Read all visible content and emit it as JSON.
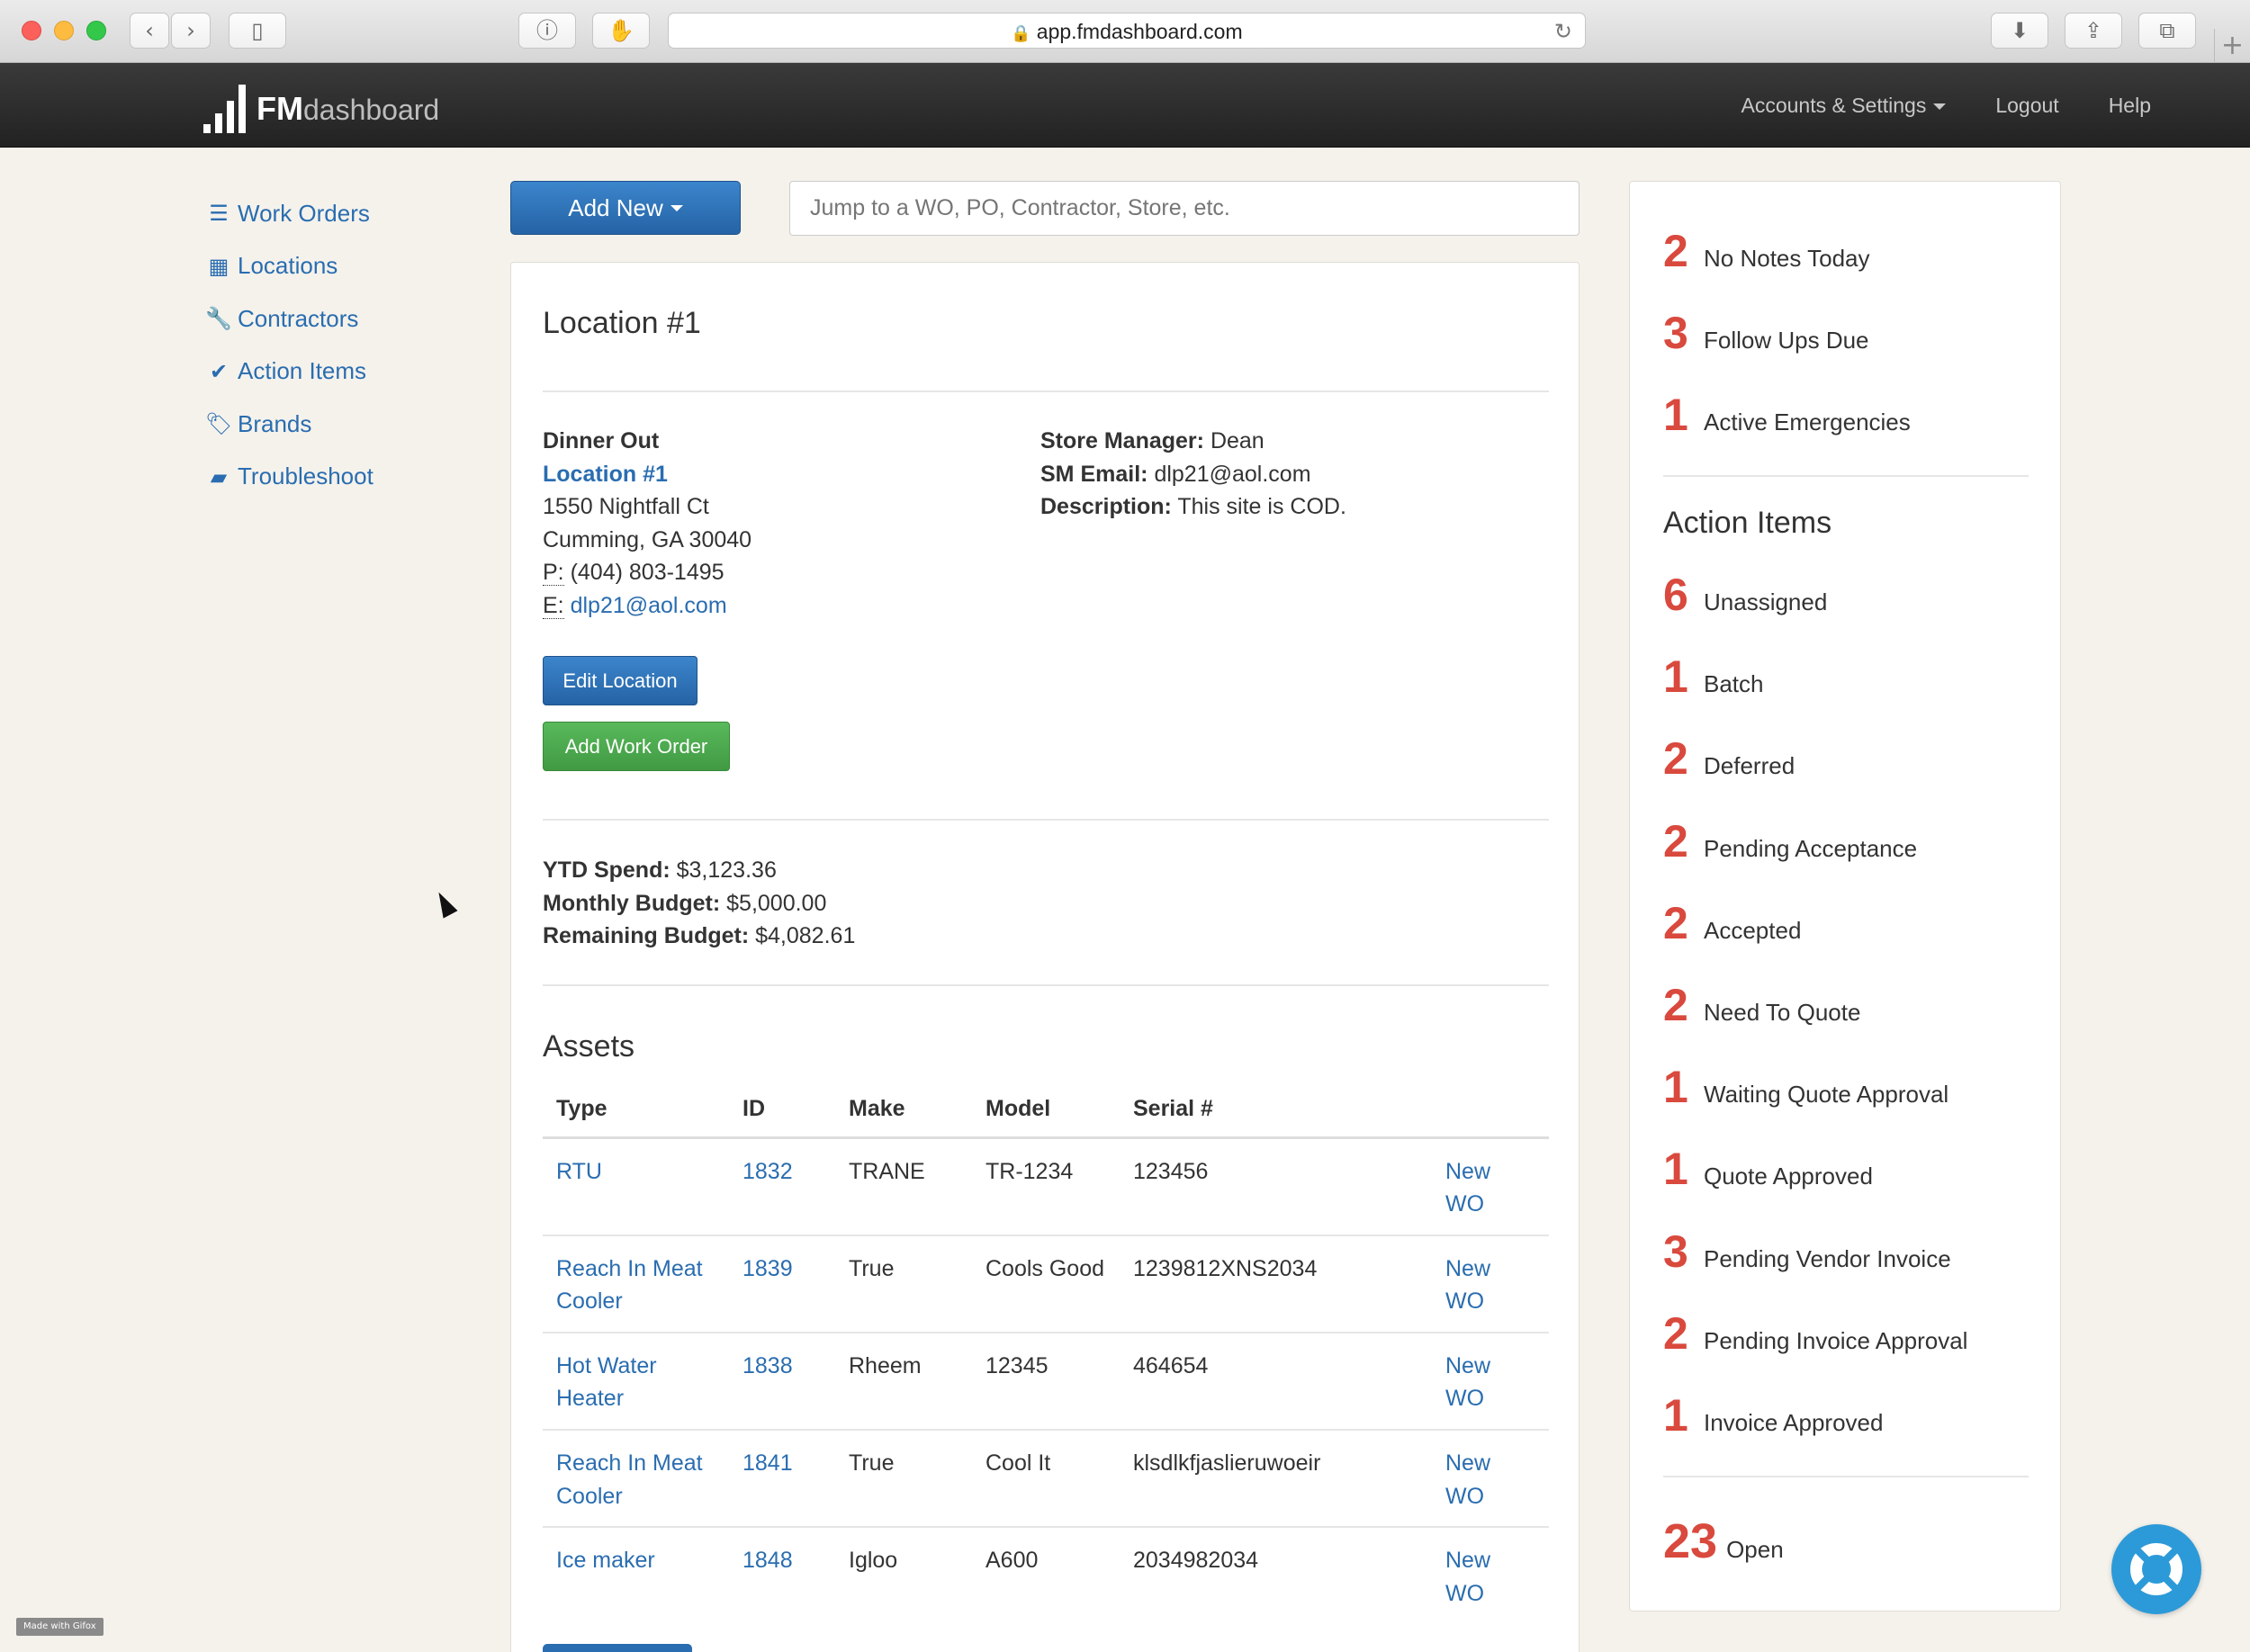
{
  "browser": {
    "url": "app.fmdashboard.com"
  },
  "navbar": {
    "logo_bold": "FM",
    "logo_light": "dashboard",
    "links": {
      "accounts": "Accounts & Settings",
      "logout": "Logout",
      "help": "Help"
    }
  },
  "sidebar": {
    "items": [
      {
        "label": "Work Orders",
        "icon": "list-icon"
      },
      {
        "label": "Locations",
        "icon": "building-icon"
      },
      {
        "label": "Contractors",
        "icon": "wrench-icon"
      },
      {
        "label": "Action Items",
        "icon": "check-icon"
      },
      {
        "label": "Brands",
        "icon": "tags-icon"
      },
      {
        "label": "Troubleshoot",
        "icon": "book-icon"
      }
    ]
  },
  "toolbar": {
    "add_new_label": "Add New",
    "search_placeholder": "Jump to a WO, PO, Contractor, Store, etc."
  },
  "location": {
    "title": "Location #1",
    "company": "Dinner Out",
    "name_link": "Location #1",
    "address1": "1550 Nightfall Ct",
    "address2": "Cumming, GA 30040",
    "phone_label": "P:",
    "phone": "(404) 803-1495",
    "email_label": "E:",
    "email": "dlp21@aol.com",
    "store_manager_label": "Store Manager:",
    "store_manager": "Dean",
    "sm_email_label": "SM Email:",
    "sm_email": "dlp21@aol.com",
    "description_label": "Description:",
    "description": "This site is COD.",
    "edit_button": "Edit Location",
    "add_wo_button": "Add Work Order"
  },
  "budget": {
    "ytd_label": "YTD Spend:",
    "ytd": "$3,123.36",
    "monthly_label": "Monthly Budget:",
    "monthly": "$5,000.00",
    "remaining_label": "Remaining Budget:",
    "remaining": "$4,082.61"
  },
  "assets": {
    "title": "Assets",
    "headers": [
      "Type",
      "ID",
      "Make",
      "Model",
      "Serial #"
    ],
    "rows": [
      {
        "type": "RTU",
        "id": "1832",
        "make": "TRANE",
        "model": "TR-1234",
        "serial": "123456",
        "action": "New WO"
      },
      {
        "type": "Reach In Meat Cooler",
        "id": "1839",
        "make": "True",
        "model": "Cools Good",
        "serial": "1239812XNS2034",
        "action": "New WO"
      },
      {
        "type": "Hot Water Heater",
        "id": "1838",
        "make": "Rheem",
        "model": "12345",
        "serial": "464654",
        "action": "New WO"
      },
      {
        "type": "Reach In Meat Cooler",
        "id": "1841",
        "make": "True",
        "model": "Cool It",
        "serial": "klsdlkfjaslieruwoeir",
        "action": "New WO"
      },
      {
        "type": "Ice maker",
        "id": "1848",
        "make": "Igloo",
        "model": "A600",
        "serial": "2034982034",
        "action": "New WO"
      }
    ]
  },
  "stats": {
    "top": [
      {
        "count": "2",
        "label": "No Notes Today"
      },
      {
        "count": "3",
        "label": "Follow Ups Due"
      },
      {
        "count": "1",
        "label": "Active Emergencies"
      }
    ],
    "action_items_title": "Action Items",
    "action_items": [
      {
        "count": "6",
        "label": "Unassigned"
      },
      {
        "count": "1",
        "label": "Batch"
      },
      {
        "count": "2",
        "label": "Deferred"
      },
      {
        "count": "2",
        "label": "Pending Acceptance"
      },
      {
        "count": "2",
        "label": "Accepted"
      },
      {
        "count": "2",
        "label": "Need To Quote"
      },
      {
        "count": "1",
        "label": "Waiting Quote Approval"
      },
      {
        "count": "1",
        "label": "Quote Approved"
      },
      {
        "count": "3",
        "label": "Pending Vendor Invoice"
      },
      {
        "count": "2",
        "label": "Pending Invoice Approval"
      },
      {
        "count": "1",
        "label": "Invoice Approved"
      }
    ],
    "open": {
      "count": "23",
      "label": "Open"
    }
  },
  "badge": "Made with Gifox",
  "colors": {
    "accent": "#2a6db0",
    "danger_count": "#d9493d",
    "success": "#4cae4c"
  }
}
